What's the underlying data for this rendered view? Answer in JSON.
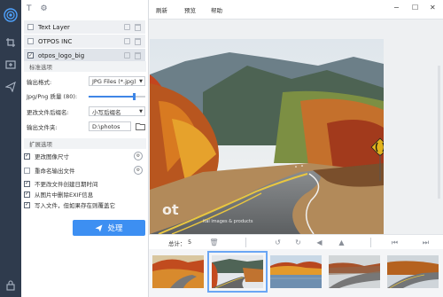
{
  "rail": {
    "icons": [
      "app-logo",
      "crop",
      "add-image",
      "send"
    ],
    "lock": "lock"
  },
  "panel": {
    "toolbar": {
      "text_tool": "T",
      "settings_tool": "⚙"
    },
    "layers": [
      {
        "name": "Text Layer",
        "checked": false
      },
      {
        "name": "OTPOS INC",
        "checked": false
      },
      {
        "name": "otpos_logo_big",
        "checked": true
      }
    ],
    "standard_section": "标准选项",
    "output_format_label": "输出格式:",
    "output_format_value": "JPG Files (*.jpg)",
    "quality_label": "Jpg/Png 质量 (80):",
    "quality_value": 0.8,
    "rename_label": "更改文件后缀名:",
    "rename_value": "小写后缀名",
    "output_folder_label": "输出文件夹:",
    "output_folder_value": "D:\\photos",
    "extended_section": "扩展选项",
    "options": [
      {
        "label": "更改图像尺寸",
        "checked": true,
        "gear": true
      },
      {
        "label": "重命名输出文件",
        "checked": false,
        "gear": true
      },
      {
        "label": "不更改文件创建日期时间",
        "checked": true,
        "gear": false
      },
      {
        "label": "从图片中删除EXIF信息",
        "checked": true,
        "gear": false
      },
      {
        "label": "写入文件，但如果存在则覆盖它",
        "checked": true,
        "gear": false
      }
    ],
    "process_label": "处理"
  },
  "titlebar": {
    "menu": [
      "刷新",
      "预览",
      "帮助"
    ],
    "window_controls": {
      "minimize": "−",
      "maximize": "☐",
      "close": "✕"
    }
  },
  "bottom_bar": {
    "total_label": "总计：",
    "total_value": "5"
  },
  "photo": {
    "watermark_logo": "ot",
    "watermark_text": "ital images & products"
  },
  "colors": {
    "accent": "#3d8ff2",
    "rail": "#2f3b4d"
  }
}
